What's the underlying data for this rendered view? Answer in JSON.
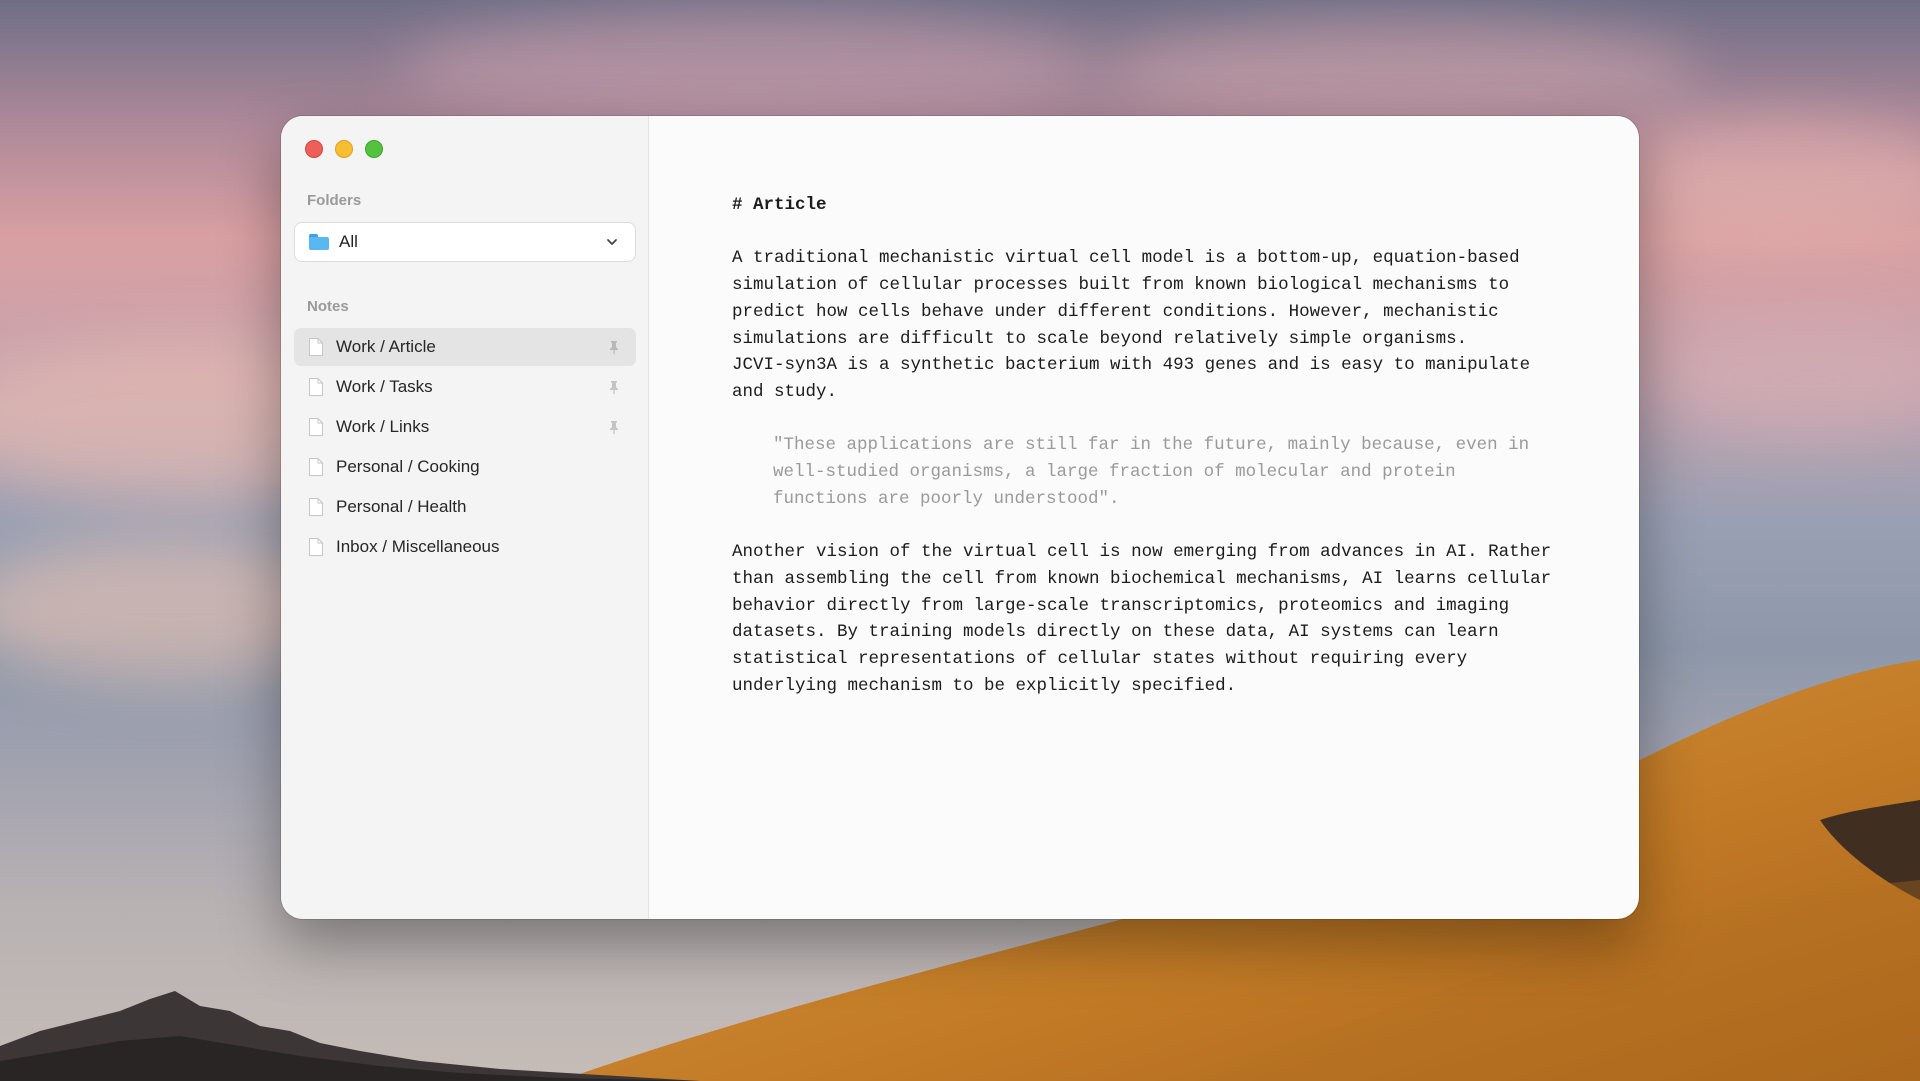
{
  "window": {
    "controls": [
      "close",
      "minimize",
      "maximize"
    ]
  },
  "sidebar": {
    "folders_label": "Folders",
    "folder_select": {
      "value": "All",
      "icon": "folder-icon"
    },
    "notes_label": "Notes",
    "notes": [
      {
        "label": "Work / Article",
        "pinned": true,
        "selected": true
      },
      {
        "label": "Work / Tasks",
        "pinned": true,
        "selected": false
      },
      {
        "label": "Work / Links",
        "pinned": true,
        "selected": false
      },
      {
        "label": "Personal / Cooking",
        "pinned": false,
        "selected": false
      },
      {
        "label": "Personal / Health",
        "pinned": false,
        "selected": false
      },
      {
        "label": "Inbox / Miscellaneous",
        "pinned": false,
        "selected": false
      }
    ]
  },
  "editor": {
    "heading": "# Article",
    "paragraph1": "A traditional mechanistic virtual cell model is a bottom-up, equation-based\nsimulation of cellular processes built from known biological mechanisms to\npredict how cells behave under different conditions. However, mechanistic\nsimulations are difficult to scale beyond relatively simple organisms.\nJCVI-syn3A is a synthetic bacterium with 493 genes and is easy to manipulate\nand study.",
    "quote": "\"These applications are still far in the future, mainly because, even in\nwell-studied organisms, a large fraction of molecular and protein\nfunctions are poorly understood\".",
    "paragraph2": "Another vision of the virtual cell is now emerging from advances in AI. Rather\nthan assembling the cell from known biochemical mechanisms, AI learns cellular\nbehavior directly from large-scale transcriptomics, proteomics and imaging\ndatasets. By training models directly on these data, AI systems can learn\nstatistical representations of cellular states without requiring every\nunderlying mechanism to be explicitly specified."
  },
  "colors": {
    "close": "#ee5f58",
    "minimize": "#f6be30",
    "maximize": "#54c13f",
    "selected_row": "#e4e4e4",
    "quote_text": "#9a9a9a"
  }
}
